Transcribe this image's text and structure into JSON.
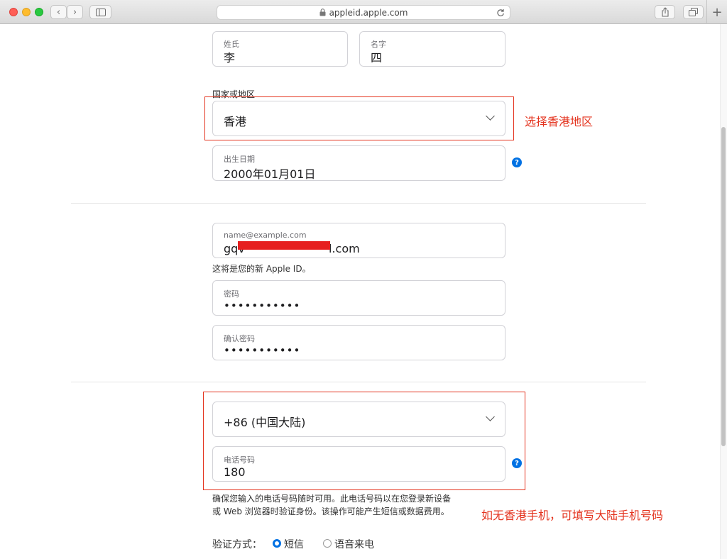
{
  "browser": {
    "url": "appleid.apple.com"
  },
  "name": {
    "last_label": "姓氏",
    "last_value": "李",
    "first_label": "名字",
    "first_value": "四"
  },
  "region": {
    "heading": "国家或地区",
    "value": "香港"
  },
  "birthday": {
    "label": "出生日期",
    "value": "2000年01月01日"
  },
  "email": {
    "label": "name@example.com",
    "value_start": "gqv",
    "value_end": "l.com",
    "hint": "这将是您的新 Apple ID。"
  },
  "password": {
    "label": "密码",
    "value": "•••••••••••"
  },
  "confirm": {
    "label": "确认密码",
    "value": "•••••••••••"
  },
  "phone": {
    "country_value": "+86 (中国大陆)",
    "label": "电话号码",
    "value": "180",
    "note_line1": "确保您输入的电话号码随时可用。此电话号码以在您登录新设备",
    "note_line2": "或 Web 浏览器时验证身份。该操作可能产生短信或数据费用。"
  },
  "verify": {
    "label": "验证方式：",
    "opt_sms": "短信",
    "opt_call": "语音来电",
    "selected": "短信"
  },
  "annotations": {
    "region_note": "选择香港地区",
    "phone_note": "如无香港手机，可填写大陆手机号码"
  },
  "colors": {
    "annotation": "#e4341f",
    "accent": "#0071e3",
    "redaction": "#e61f1f"
  }
}
